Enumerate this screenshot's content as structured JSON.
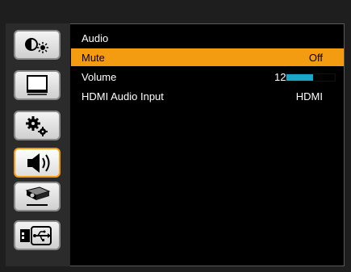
{
  "sidebar": {
    "items": [
      {
        "icon": "picture-icon",
        "active": false
      },
      {
        "icon": "screen-icon",
        "active": false
      },
      {
        "icon": "settings-icon",
        "active": false
      },
      {
        "icon": "speaker-icon",
        "active": true
      },
      {
        "icon": "projector-icon",
        "active": false
      },
      {
        "icon": "usb-icon",
        "active": false
      }
    ]
  },
  "menu": {
    "title": "Audio",
    "rows": [
      {
        "label": "Mute",
        "value": "Off",
        "selected": true
      },
      {
        "label": "Volume",
        "value": "12",
        "level_percent": 55
      },
      {
        "label": "HDMI Audio Input",
        "value": "HDMI"
      }
    ]
  },
  "colors": {
    "accent": "#f39c12",
    "volume_fill": "#19a6c8",
    "background": "#000000"
  }
}
